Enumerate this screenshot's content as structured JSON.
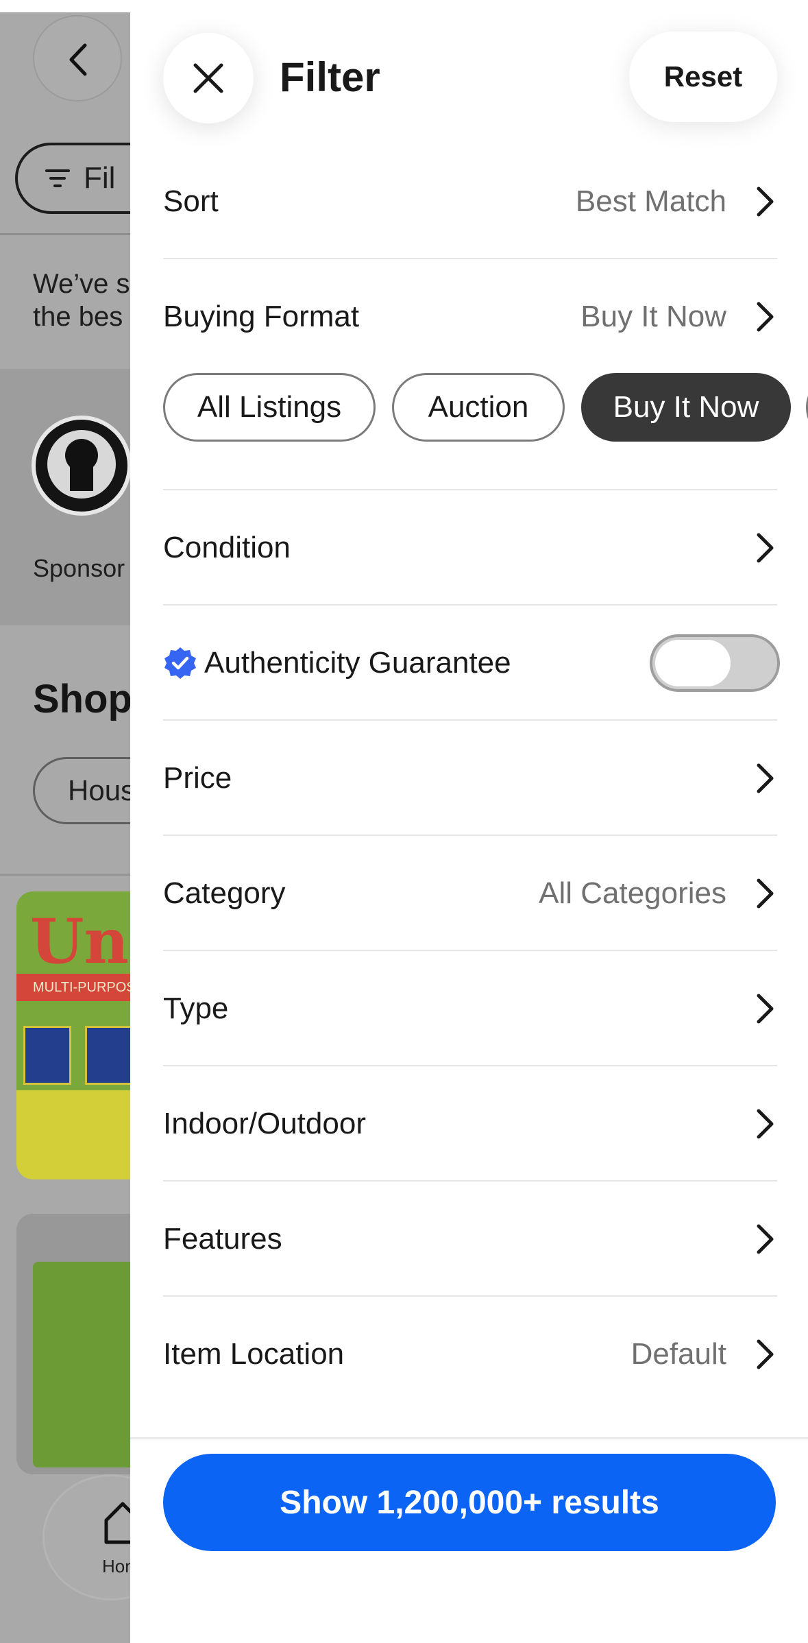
{
  "background": {
    "filters_chip_label": "Fil",
    "notice_line1": "We’ve s",
    "notice_line2": "the bes",
    "sponsored_label": "Sponsor",
    "shop_heading": "Shop",
    "house_chip_label": "Hous",
    "product_brand": "Uni",
    "product_band": "MULTI-PURPOSE",
    "home_label": "Hon"
  },
  "sheet": {
    "title": "Filter",
    "reset_label": "Reset",
    "sort": {
      "label": "Sort",
      "value": "Best Match"
    },
    "buying_format": {
      "label": "Buying Format",
      "value": "Buy It Now",
      "chips": [
        "All Listings",
        "Auction",
        "Buy It Now"
      ],
      "selected": "Buy It Now"
    },
    "condition": {
      "label": "Condition"
    },
    "authenticity": {
      "label": "Authenticity Guarantee",
      "enabled": false
    },
    "price": {
      "label": "Price"
    },
    "category": {
      "label": "Category",
      "value": "All Categories"
    },
    "type": {
      "label": "Type"
    },
    "indoor_outdoor": {
      "label": "Indoor/Outdoor"
    },
    "features": {
      "label": "Features"
    },
    "item_location": {
      "label": "Item Location",
      "value": "Default"
    },
    "show_results_label": "Show 1,200,000+ results"
  },
  "colors": {
    "accent_blue": "#0b64f4",
    "selected_chip": "#383838",
    "overlay_gray": "#a9a9a9"
  }
}
